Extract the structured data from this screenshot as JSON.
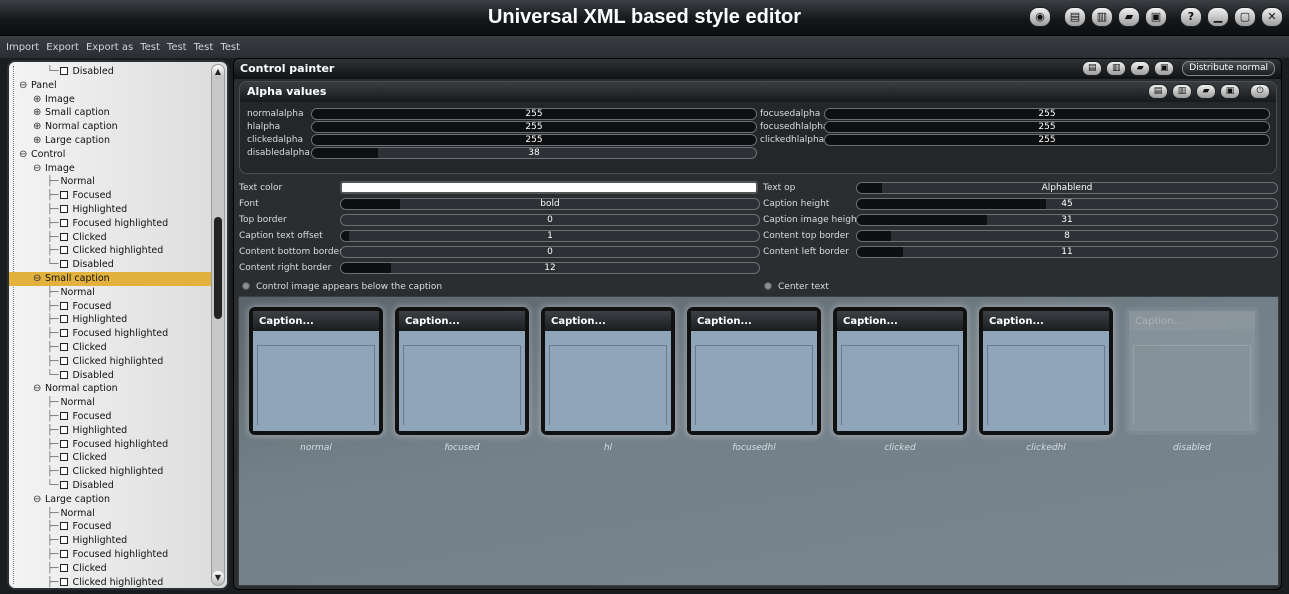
{
  "window": {
    "title": "Universal XML based style editor"
  },
  "menu": {
    "items": [
      "Import",
      "Export",
      "Export as",
      "Test",
      "Test",
      "Test",
      "Test"
    ]
  },
  "tree": {
    "rows": [
      {
        "label": "Disabled",
        "indent": 2,
        "kind": "box",
        "joint": "└"
      },
      {
        "label": "Panel",
        "indent": 0,
        "kind": "minus"
      },
      {
        "label": "Image",
        "indent": 1,
        "kind": "plus"
      },
      {
        "label": "Small caption",
        "indent": 1,
        "kind": "plus"
      },
      {
        "label": "Normal caption",
        "indent": 1,
        "kind": "plus"
      },
      {
        "label": "Large caption",
        "indent": 1,
        "kind": "plus"
      },
      {
        "label": "Control",
        "indent": 0,
        "kind": "minus"
      },
      {
        "label": "Image",
        "indent": 1,
        "kind": "minus"
      },
      {
        "label": "Normal",
        "indent": 2,
        "kind": "line",
        "joint": "├"
      },
      {
        "label": "Focused",
        "indent": 2,
        "kind": "box",
        "joint": "├"
      },
      {
        "label": "Highlighted",
        "indent": 2,
        "kind": "box",
        "joint": "├"
      },
      {
        "label": "Focused highlighted",
        "indent": 2,
        "kind": "box",
        "joint": "├"
      },
      {
        "label": "Clicked",
        "indent": 2,
        "kind": "box",
        "joint": "├"
      },
      {
        "label": "Clicked highlighted",
        "indent": 2,
        "kind": "box",
        "joint": "├"
      },
      {
        "label": "Disabled",
        "indent": 2,
        "kind": "box",
        "joint": "└"
      },
      {
        "label": "Small caption",
        "indent": 1,
        "kind": "minus",
        "selected": true
      },
      {
        "label": "Normal",
        "indent": 2,
        "kind": "line",
        "joint": "├"
      },
      {
        "label": "Focused",
        "indent": 2,
        "kind": "box",
        "joint": "├"
      },
      {
        "label": "Highlighted",
        "indent": 2,
        "kind": "box",
        "joint": "├"
      },
      {
        "label": "Focused highlighted",
        "indent": 2,
        "kind": "box",
        "joint": "├"
      },
      {
        "label": "Clicked",
        "indent": 2,
        "kind": "box",
        "joint": "├"
      },
      {
        "label": "Clicked highlighted",
        "indent": 2,
        "kind": "box",
        "joint": "├"
      },
      {
        "label": "Disabled",
        "indent": 2,
        "kind": "box",
        "joint": "└"
      },
      {
        "label": "Normal caption",
        "indent": 1,
        "kind": "minus"
      },
      {
        "label": "Normal",
        "indent": 2,
        "kind": "line",
        "joint": "├"
      },
      {
        "label": "Focused",
        "indent": 2,
        "kind": "box",
        "joint": "├"
      },
      {
        "label": "Highlighted",
        "indent": 2,
        "kind": "box",
        "joint": "├"
      },
      {
        "label": "Focused highlighted",
        "indent": 2,
        "kind": "box",
        "joint": "├"
      },
      {
        "label": "Clicked",
        "indent": 2,
        "kind": "box",
        "joint": "├"
      },
      {
        "label": "Clicked highlighted",
        "indent": 2,
        "kind": "box",
        "joint": "├"
      },
      {
        "label": "Disabled",
        "indent": 2,
        "kind": "box",
        "joint": "└"
      },
      {
        "label": "Large caption",
        "indent": 1,
        "kind": "minus"
      },
      {
        "label": "Normal",
        "indent": 2,
        "kind": "line",
        "joint": "├"
      },
      {
        "label": "Focused",
        "indent": 2,
        "kind": "box",
        "joint": "├"
      },
      {
        "label": "Highlighted",
        "indent": 2,
        "kind": "box",
        "joint": "├"
      },
      {
        "label": "Focused highlighted",
        "indent": 2,
        "kind": "box",
        "joint": "├"
      },
      {
        "label": "Clicked",
        "indent": 2,
        "kind": "box",
        "joint": "├"
      },
      {
        "label": "Clicked highlighted",
        "indent": 2,
        "kind": "box",
        "joint": "├"
      }
    ]
  },
  "painter": {
    "title": "Control painter",
    "distribute_label": "Distribute normal"
  },
  "alpha": {
    "title": "Alpha values",
    "left": [
      {
        "label": "normalalpha",
        "value": "255",
        "fraction": 1.0
      },
      {
        "label": "hlalpha",
        "value": "255",
        "fraction": 1.0
      },
      {
        "label": "clickedalpha",
        "value": "255",
        "fraction": 1.0
      },
      {
        "label": "disabledalpha",
        "value": "38",
        "fraction": 0.149
      }
    ],
    "right": [
      {
        "label": "focusedalpha",
        "value": "255",
        "fraction": 1.0
      },
      {
        "label": "focusedhlalpha",
        "value": "255",
        "fraction": 1.0
      },
      {
        "label": "clickedhlalpha",
        "value": "255",
        "fraction": 1.0
      }
    ]
  },
  "props": {
    "left": [
      {
        "label": "Text color",
        "type": "color"
      },
      {
        "label": "Font",
        "value": "bold",
        "fraction": 0.14
      },
      {
        "label": "Top border",
        "value": "0",
        "fraction": 0.0
      },
      {
        "label": "Caption text offset",
        "value": "1",
        "fraction": 0.02
      },
      {
        "label": "Content bottom border",
        "value": "0",
        "fraction": 0.0
      },
      {
        "label": "Content right border",
        "value": "12",
        "fraction": 0.12
      }
    ],
    "right": [
      {
        "label": "Text op",
        "value": "Alphablend",
        "fraction": 0.06
      },
      {
        "label": "Caption height",
        "value": "45",
        "fraction": 0.45
      },
      {
        "label": "Caption image height",
        "value": "31",
        "fraction": 0.31
      },
      {
        "label": "Content top border",
        "value": "8",
        "fraction": 0.08
      },
      {
        "label": "Content left border",
        "value": "11",
        "fraction": 0.11
      }
    ],
    "text_color": "#ffffff"
  },
  "options": {
    "image_below_caption": "Control image appears below the caption",
    "center_text": "Center text"
  },
  "preview": {
    "items": [
      {
        "caption": "Caption...",
        "state": "normal"
      },
      {
        "caption": "Caption...",
        "state": "focused"
      },
      {
        "caption": "Caption...",
        "state": "hl"
      },
      {
        "caption": "Caption...",
        "state": "focusedhl"
      },
      {
        "caption": "Caption...",
        "state": "clicked"
      },
      {
        "caption": "Caption...",
        "state": "clickedhl"
      },
      {
        "caption": "Caption...",
        "state": "disabled",
        "disabled": true
      }
    ]
  },
  "icons": {
    "window": [
      "eye-icon",
      "copy-icon",
      "paste-icon",
      "open-icon",
      "save-icon",
      "help-icon",
      "minimize-icon",
      "maximize-icon",
      "close-icon"
    ],
    "painter": [
      "copy-icon",
      "paste-icon",
      "open-icon",
      "save-icon"
    ],
    "alpha": [
      "copy-icon",
      "paste-icon",
      "open-icon",
      "save-icon",
      "power-icon"
    ]
  }
}
